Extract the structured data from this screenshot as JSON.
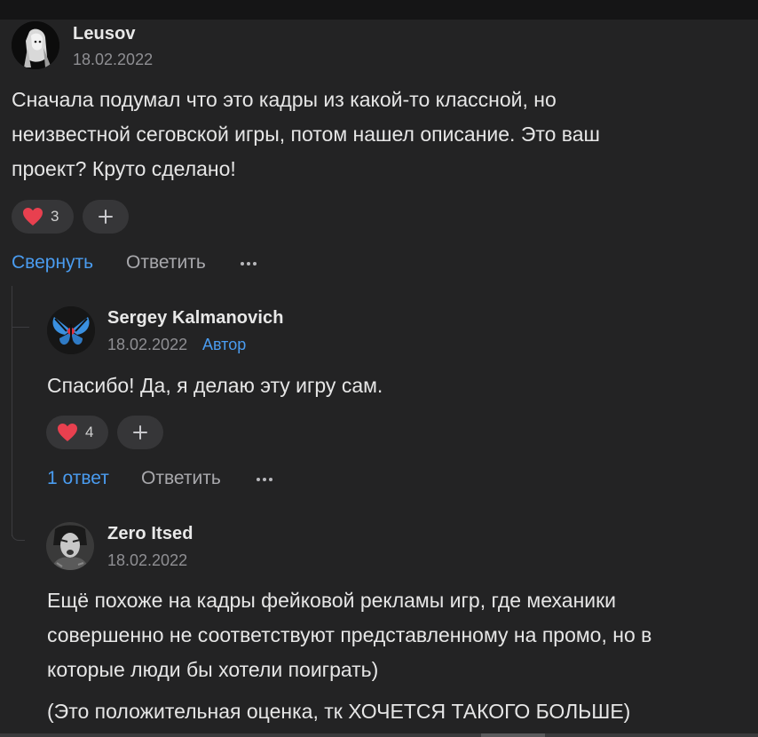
{
  "comments": [
    {
      "author": "Leusov",
      "date": "18.02.2022",
      "text_lines": [
        "Сначала подумал что это кадры из какой-то классной, но",
        "неизвестной сеговской игры, потом нашел описание. Это ваш",
        "проект? Круто сделано!"
      ],
      "likes": "3",
      "actions": {
        "collapse": "Свернуть",
        "reply": "Ответить"
      }
    },
    {
      "author": "Sergey Kalmanovich",
      "date": "18.02.2022",
      "badge": "Автор",
      "text_lines": [
        "Спасибо! Да, я делаю эту игру сам."
      ],
      "likes": "4",
      "actions": {
        "replies": "1 ответ",
        "reply": "Ответить"
      }
    },
    {
      "author": "Zero Itsed",
      "date": "18.02.2022",
      "text_lines": [
        "Ещё похоже на кадры фейковой рекламы игр, где механики",
        "совершенно не соответствуют представленному на промо, но в",
        "которые люди бы хотели поиграть)"
      ],
      "text_extra": "(Это положительная оценка, тк ХОЧЕТСЯ ТАКОГО БОЛЬШЕ)"
    }
  ],
  "icons": {
    "reaction": "heart-icon",
    "add": "plus-icon",
    "more": "more-dots-icon"
  },
  "colors": {
    "background": "#232324",
    "accent": "#4a9cf0",
    "heart": "#e8404f"
  }
}
